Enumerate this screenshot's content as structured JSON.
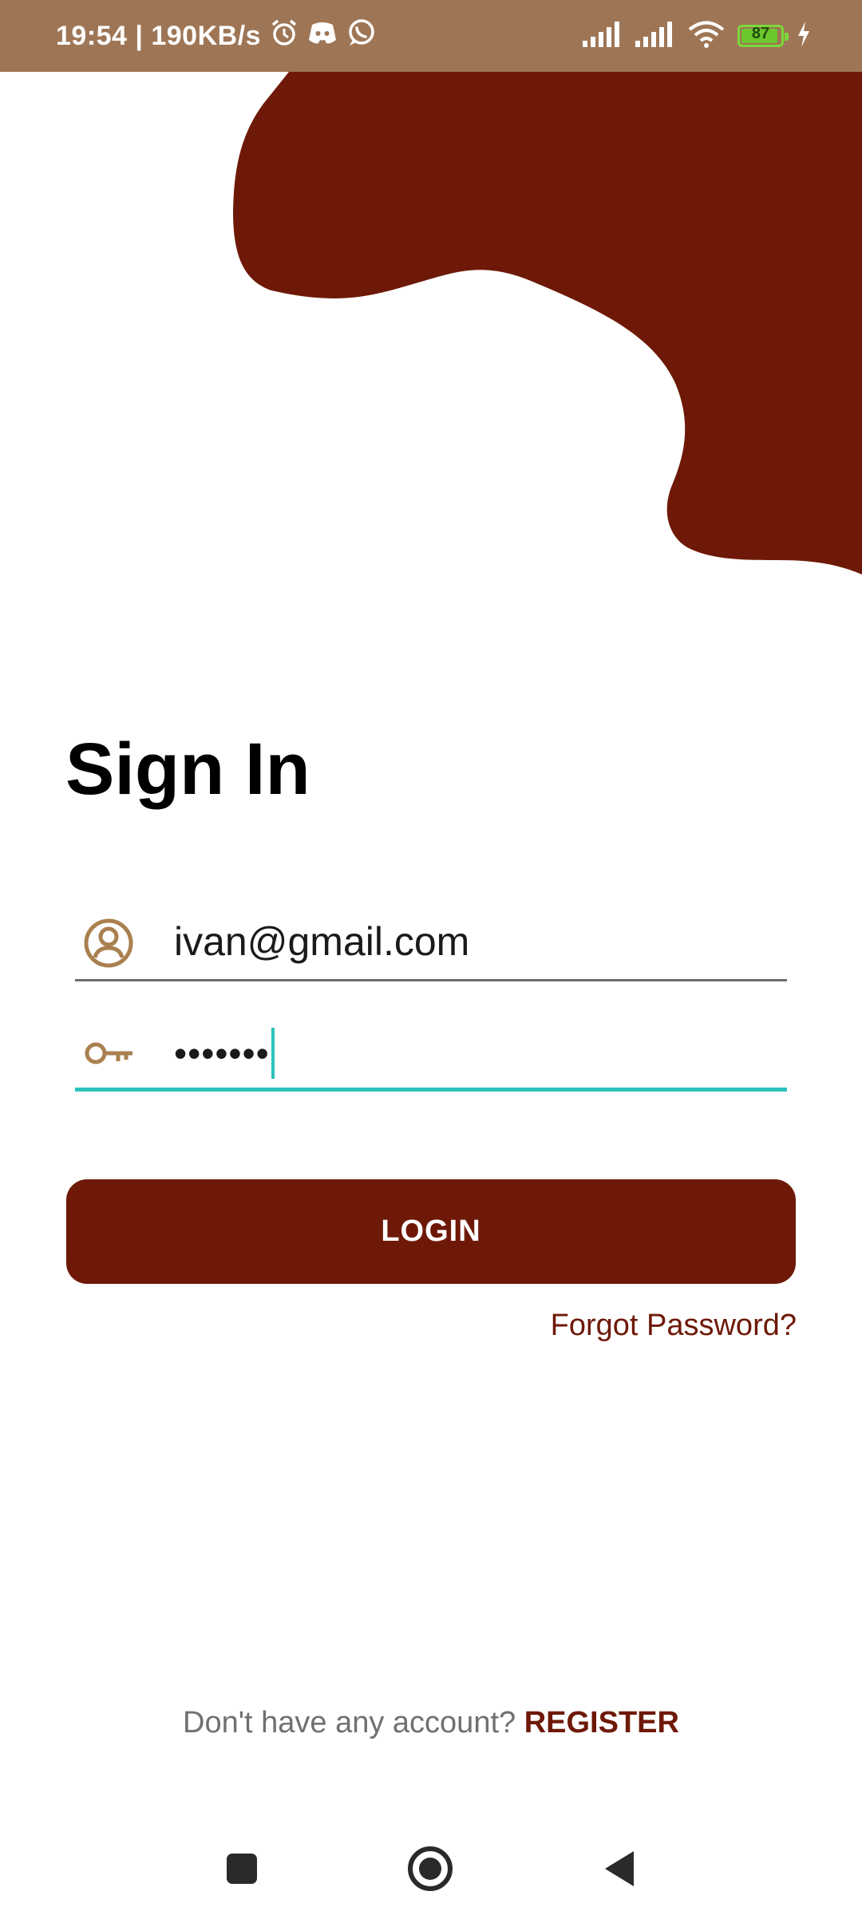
{
  "status_bar": {
    "time_and_speed": "19:54 | 190KB/s",
    "battery_level": "87",
    "icons": [
      "alarm-icon",
      "discord-icon",
      "whatsapp-icon",
      "signal-icon",
      "signal-icon",
      "wifi-icon",
      "battery-icon",
      "charging-icon"
    ]
  },
  "colors": {
    "brand": "#6e1907",
    "status_bar_bg": "#9e7656",
    "icon_tint": "#a9804f",
    "focus_underline": "#2ac3bb"
  },
  "screen": {
    "title": "Sign In"
  },
  "form": {
    "email_value": "ivan@gmail.com",
    "email_icon": "account-circle-icon",
    "password_masked": "•••••••",
    "password_icon": "key-icon"
  },
  "actions": {
    "login_label": "LOGIN",
    "forgot_label": "Forgot Password?",
    "no_account_text": "Don't have any account? ",
    "register_label": "REGISTER"
  },
  "nav": {
    "icons": [
      "recents-icon",
      "home-icon",
      "back-icon"
    ]
  }
}
